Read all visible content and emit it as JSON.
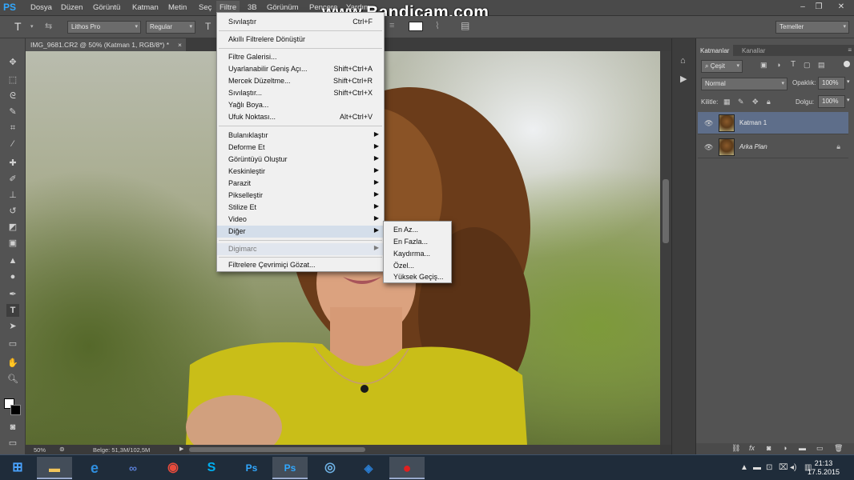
{
  "menubar": {
    "logo": "PS",
    "items": [
      "Dosya",
      "Düzen",
      "Görüntü",
      "Katman",
      "Metin",
      "Seç",
      "Filtre",
      "3B",
      "Görünüm",
      "Pencere",
      "Yardım"
    ],
    "watermark": "www.Bandicam.com"
  },
  "options_bar": {
    "font_family": "Lithos Pro",
    "font_style": "Regular",
    "workspace": "Temeller"
  },
  "document": {
    "tab_title": "IMG_9681.CR2 @ 50% (Katman 1, RGB/8*) *",
    "zoom": "50%",
    "doc_size": "Belge: 51,3M/102,5M"
  },
  "filter_menu": {
    "last_filter": "Sıvılaştır",
    "last_filter_shortcut": "Ctrl+F",
    "smart_filters": "Akıllı Filtrelere Dönüştür",
    "items": [
      {
        "label": "Filtre Galerisi...",
        "shortcut": ""
      },
      {
        "label": "Uyarlanabilir Geniş Açı...",
        "shortcut": "Shift+Ctrl+A"
      },
      {
        "label": "Mercek Düzeltme...",
        "shortcut": "Shift+Ctrl+R"
      },
      {
        "label": "Sıvılaştır...",
        "shortcut": "Shift+Ctrl+X"
      },
      {
        "label": "Yağlı Boya...",
        "shortcut": ""
      },
      {
        "label": "Ufuk Noktası...",
        "shortcut": "Alt+Ctrl+V"
      }
    ],
    "submenus": [
      "Bulanıklaştır",
      "Deforme Et",
      "Görüntüyü Oluştur",
      "Keskinleştir",
      "Parazit",
      "Pikselleştir",
      "Stilize Et",
      "Video",
      "Diğer"
    ],
    "digimarc": "Digimarc",
    "browse_online": "Filtrelere Çevrimiçi Gözat..."
  },
  "other_submenu": [
    "En Az...",
    "En Fazla...",
    "Kaydırma...",
    "Özel...",
    "Yüksek Geçiş..."
  ],
  "layers_panel": {
    "tabs": [
      "Katmanlar",
      "Kanallar"
    ],
    "filter_kind": "Çeşit",
    "blend_mode": "Normal",
    "opacity_label": "Opaklık:",
    "opacity_value": "100%",
    "lock_label": "Kilitle:",
    "fill_label": "Dolgu:",
    "fill_value": "100%",
    "layers": [
      {
        "name": "Katman 1",
        "selected": true,
        "locked": false
      },
      {
        "name": "Arka Plan",
        "selected": false,
        "locked": true
      }
    ]
  },
  "taskbar": {
    "time": "21:13",
    "date": "17.5.2015",
    "apps": [
      "file-explorer",
      "internet-explorer",
      "app-icon",
      "chrome",
      "skype",
      "photoshop",
      "photoshop",
      "camera-app",
      "outlook-app",
      "bandicam-record"
    ]
  }
}
